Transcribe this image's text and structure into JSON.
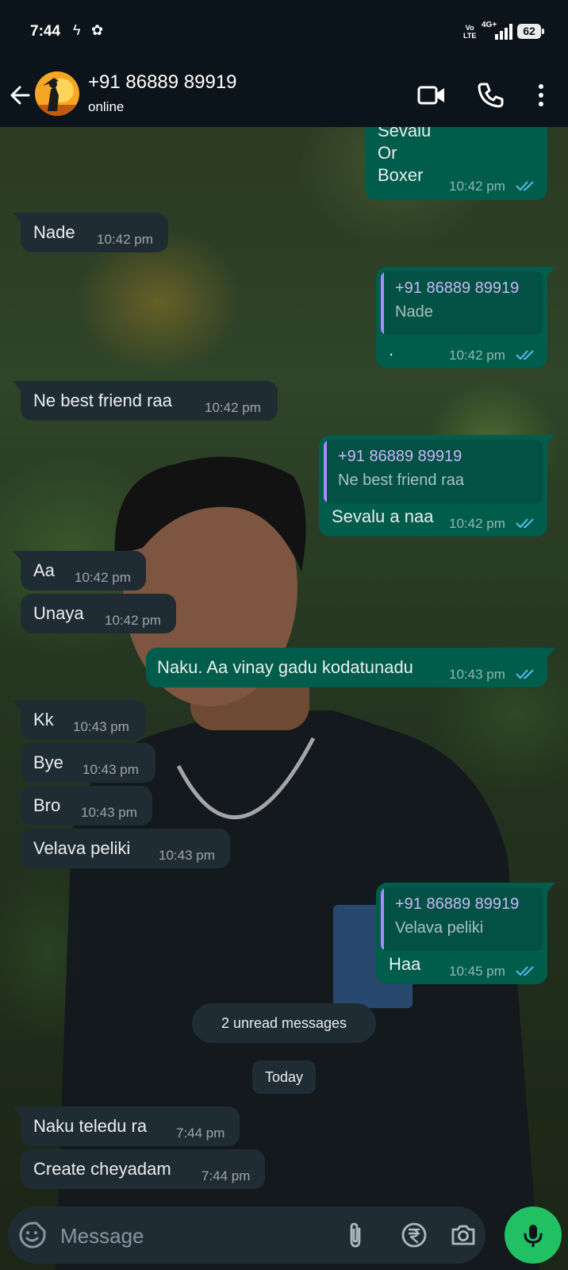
{
  "status_bar": {
    "time": "7:44",
    "icon_left_1": "flash-icon",
    "icon_left_2": "app-icon",
    "volte": "Vo\nLTE",
    "network": "4G+",
    "battery": "62"
  },
  "header": {
    "title": "+91 86889 89919",
    "subtitle": "online"
  },
  "messages": [
    {
      "dir": "out",
      "lines": [
        "Sevalu",
        "Or",
        "Boxer"
      ],
      "time": "10:42 pm",
      "read": true
    },
    {
      "dir": "in",
      "text": "Nade",
      "time": "10:42 pm"
    },
    {
      "dir": "out",
      "quote_name": "+91 86889 89919",
      "quote_text": "Nade",
      "text": ".",
      "time": "10:42 pm",
      "read": true
    },
    {
      "dir": "in",
      "text": "Ne best friend raa",
      "time": "10:42 pm"
    },
    {
      "dir": "out",
      "quote_name": "+91 86889 89919",
      "quote_text": "Ne best friend raa",
      "text": "Sevalu a naa",
      "time": "10:42 pm",
      "read": true
    },
    {
      "dir": "in",
      "text": "Aa",
      "time": "10:42 pm"
    },
    {
      "dir": "in",
      "text": "Unaya",
      "time": "10:42 pm"
    },
    {
      "dir": "out",
      "text": "Naku. Aa vinay gadu kodatunadu",
      "time": "10:43 pm",
      "read": true
    },
    {
      "dir": "in",
      "text": "Kk",
      "time": "10:43 pm"
    },
    {
      "dir": "in",
      "text": "Bye",
      "time": "10:43 pm"
    },
    {
      "dir": "in",
      "text": "Bro",
      "time": "10:43 pm"
    },
    {
      "dir": "in",
      "text": "Velava peliki",
      "time": "10:43 pm"
    },
    {
      "dir": "out",
      "quote_name": "+91 86889 89919",
      "quote_text": "Velava peliki",
      "text": "Haa",
      "time": "10:45 pm",
      "read": true
    },
    {
      "dir": "in",
      "text": "Naku teledu ra",
      "time": "7:44 pm"
    },
    {
      "dir": "in",
      "text": "Create cheyadam",
      "time": "7:44 pm"
    }
  ],
  "unread_label": "2 unread messages",
  "date_label": "Today",
  "composer": {
    "placeholder": "Message"
  },
  "colors": {
    "header_bg": "#0b141a",
    "incoming_bubble": "#202c33",
    "outgoing_bubble": "#005c4b",
    "read_tick": "#53bdeb",
    "mic_button": "#21c063",
    "quote_accent": "#a78bfa"
  },
  "icons": [
    "back-arrow-icon",
    "video-call-icon",
    "phone-icon",
    "more-options-icon",
    "emoji-sticker-icon",
    "attach-icon",
    "rupee-payment-icon",
    "camera-icon",
    "mic-icon",
    "double-tick-icon"
  ]
}
